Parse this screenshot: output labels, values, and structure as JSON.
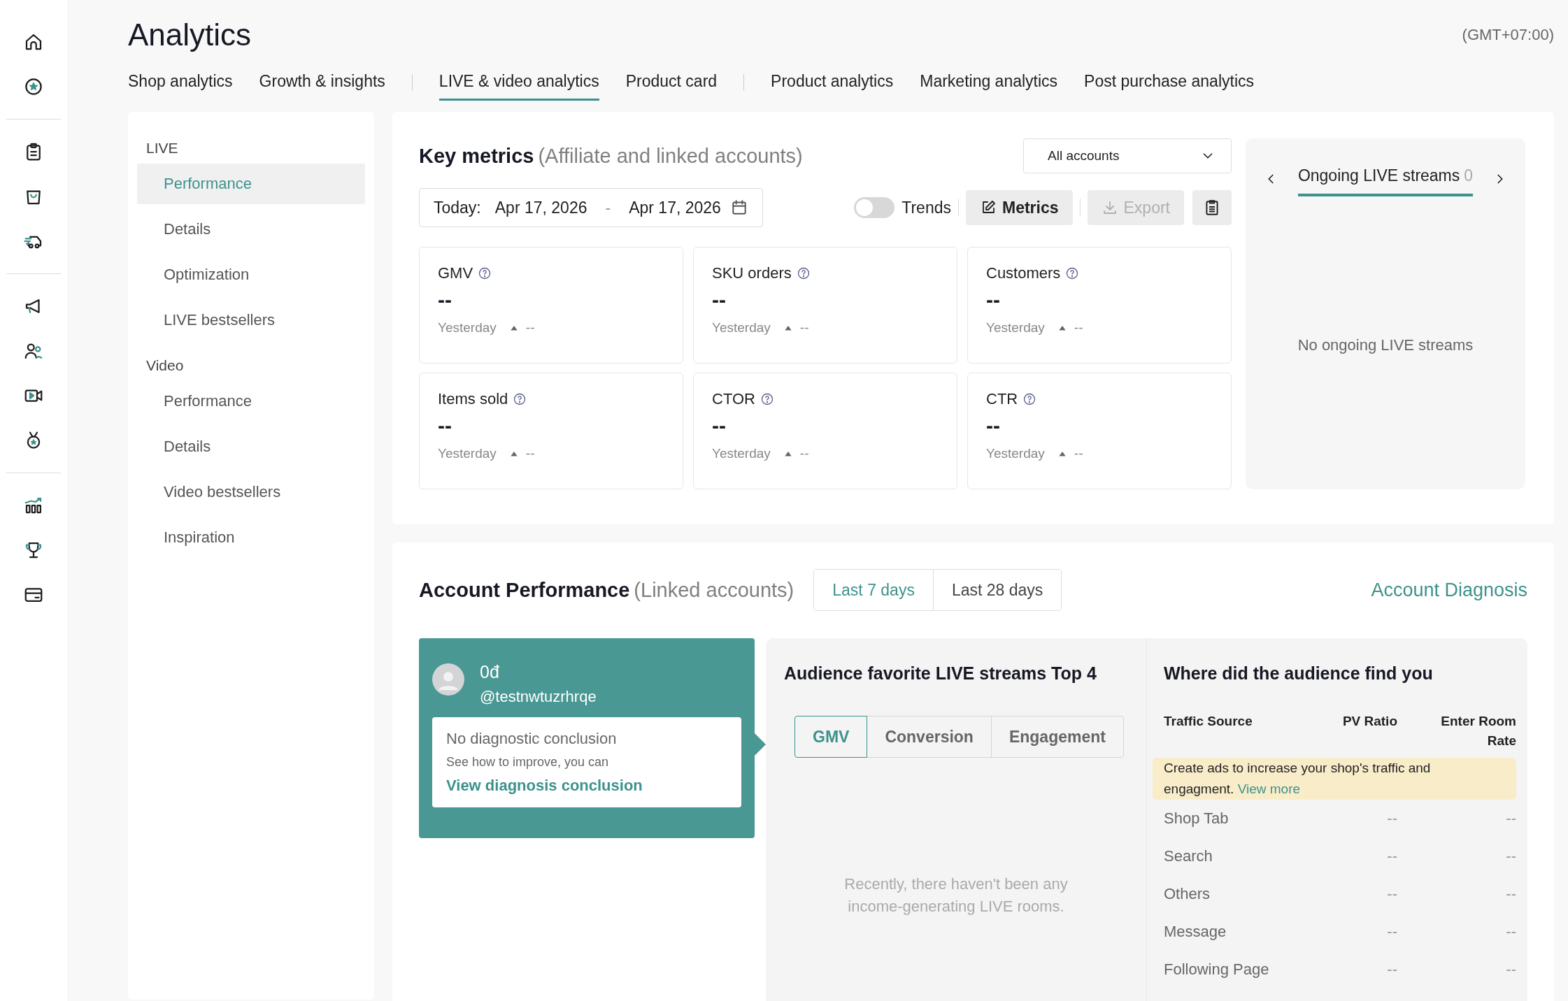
{
  "header": {
    "title": "Analytics",
    "timezone": "(GMT+07:00)"
  },
  "tab_groups": [
    [
      {
        "label": "Shop analytics",
        "selected": false
      },
      {
        "label": "Growth & insights",
        "selected": false
      }
    ],
    [
      {
        "label": "LIVE & video analytics",
        "selected": true
      },
      {
        "label": "Product card",
        "selected": false
      }
    ],
    [
      {
        "label": "Product analytics",
        "selected": false
      },
      {
        "label": "Marketing analytics",
        "selected": false
      },
      {
        "label": "Post purchase analytics",
        "selected": false
      }
    ]
  ],
  "nav": [
    {
      "heading": "LIVE",
      "items": [
        {
          "label": "Performance",
          "selected": true
        },
        {
          "label": "Details",
          "selected": false
        },
        {
          "label": "Optimization",
          "selected": false
        },
        {
          "label": "LIVE bestsellers",
          "selected": false
        }
      ]
    },
    {
      "heading": "Video",
      "items": [
        {
          "label": "Performance",
          "selected": false
        },
        {
          "label": "Details",
          "selected": false
        },
        {
          "label": "Video bestsellers",
          "selected": false
        },
        {
          "label": "Inspiration",
          "selected": false
        }
      ]
    }
  ],
  "key_metrics": {
    "title": "Key metrics",
    "subtitle": "(Affiliate and linked accounts)",
    "account_select": "All accounts",
    "date": {
      "prefix": "Today:",
      "start": "Apr 17, 2026",
      "separator": "-",
      "end": "Apr 17, 2026"
    },
    "trends": {
      "label": "Trends",
      "on": false
    },
    "metrics_button": "Metrics",
    "export_button": {
      "label": "Export",
      "disabled": true
    },
    "cards": [
      {
        "name": "GMV",
        "value": "--",
        "compare_label": "Yesterday",
        "change": "--"
      },
      {
        "name": "SKU orders",
        "value": "--",
        "compare_label": "Yesterday",
        "change": "--"
      },
      {
        "name": "Customers",
        "value": "--",
        "compare_label": "Yesterday",
        "change": "--"
      },
      {
        "name": "Items sold",
        "value": "--",
        "compare_label": "Yesterday",
        "change": "--"
      },
      {
        "name": "CTOR",
        "value": "--",
        "compare_label": "Yesterday",
        "change": "--"
      },
      {
        "name": "CTR",
        "value": "--",
        "compare_label": "Yesterday",
        "change": "--"
      }
    ]
  },
  "live_panel": {
    "tab": "Ongoing LIVE streams",
    "count": "0",
    "empty": "No ongoing LIVE streams"
  },
  "account_performance": {
    "title": "Account Performance",
    "subtitle": "(Linked accounts)",
    "ranges": [
      {
        "label": "Last 7 days",
        "selected": true
      },
      {
        "label": "Last 28 days",
        "selected": false
      }
    ],
    "diagnosis_link": "Account Diagnosis",
    "account": {
      "balance": "0đ",
      "handle": "@testnwtuzrhrqe",
      "conclusion": "No diagnostic conclusion",
      "hint": "See how to improve, you can",
      "link": "View diagnosis conclusion"
    },
    "favorites": {
      "title": "Audience favorite LIVE streams Top 4",
      "tabs": [
        {
          "label": "GMV",
          "selected": true
        },
        {
          "label": "Conversion",
          "selected": false
        },
        {
          "label": "Engagement",
          "selected": false
        }
      ],
      "empty": "Recently, there haven't been any income-generating LIVE rooms."
    },
    "traffic": {
      "title": "Where did the audience find you",
      "columns": [
        "Traffic Source",
        "PV Ratio",
        "Enter Room Rate"
      ],
      "notice": "Create ads to increase your shop's traffic and engagment.",
      "notice_link": "View more",
      "rows": [
        {
          "source": "Shop Tab",
          "pv_ratio": "--",
          "enter_room_rate": "--"
        },
        {
          "source": "Search",
          "pv_ratio": "--",
          "enter_room_rate": "--"
        },
        {
          "source": "Others",
          "pv_ratio": "--",
          "enter_room_rate": "--"
        },
        {
          "source": "Message",
          "pv_ratio": "--",
          "enter_room_rate": "--"
        },
        {
          "source": "Following Page",
          "pv_ratio": "--",
          "enter_room_rate": "--"
        }
      ]
    }
  }
}
